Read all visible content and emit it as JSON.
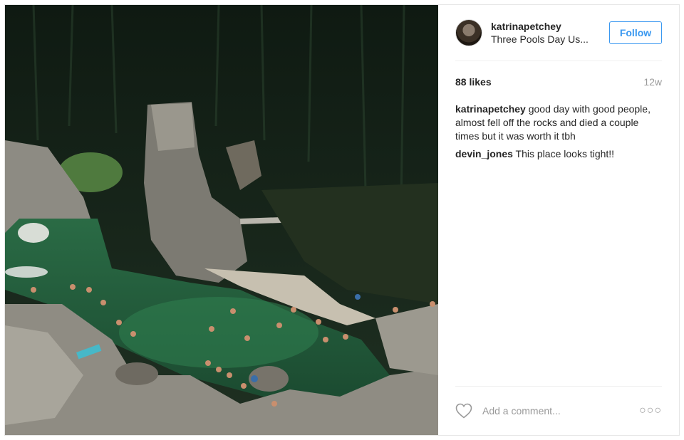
{
  "post": {
    "username": "katrinapetchey",
    "location": "Three Pools Day Us...",
    "follow_label": "Follow",
    "likes": "88 likes",
    "time_ago": "12w",
    "comments": [
      {
        "user": "katrinapetchey",
        "text": " good day with good people, almost fell off the rocks and died a couple times but it was worth it tbh"
      },
      {
        "user": "devin_jones",
        "text": " This place looks tight!!"
      }
    ],
    "comment_placeholder": "Add a comment...",
    "more_label": "○○○",
    "icons": {
      "like": "heart-icon",
      "more": "more-options-icon"
    },
    "colors": {
      "accent": "#3897f0",
      "muted": "#999999",
      "text": "#262626"
    }
  }
}
